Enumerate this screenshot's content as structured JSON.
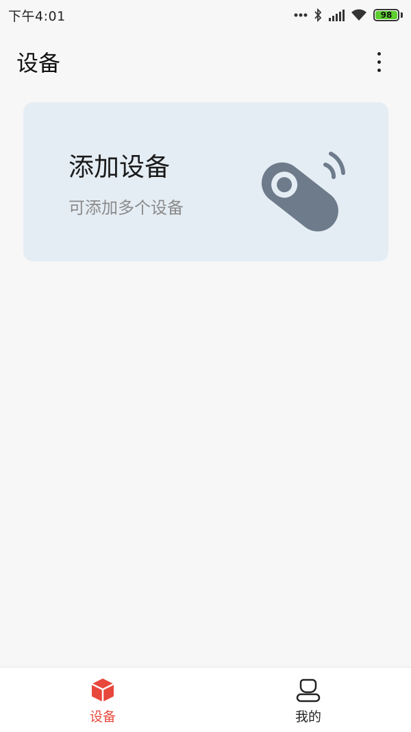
{
  "status_bar": {
    "time": "下午4:01",
    "battery": "98"
  },
  "header": {
    "title": "设备"
  },
  "add_card": {
    "title": "添加设备",
    "subtitle": "可添加多个设备"
  },
  "bottom_nav": {
    "items": [
      {
        "label": "设备",
        "icon": "device-cube-icon",
        "active": true
      },
      {
        "label": "我的",
        "icon": "profile-icon",
        "active": false
      }
    ]
  },
  "colors": {
    "accent": "#e8473b",
    "card_bg": "#e5edf4",
    "remote_icon": "#6e7b8b",
    "battery_fill": "#5ccf2e"
  }
}
